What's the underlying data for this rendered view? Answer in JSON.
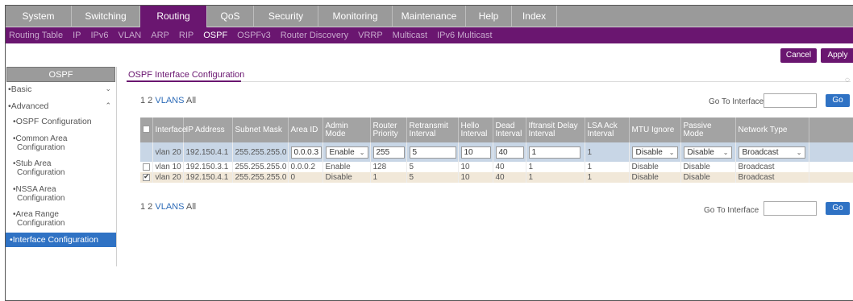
{
  "top_nav": {
    "tabs": [
      {
        "label": "System",
        "width": 82
      },
      {
        "label": "Switching",
        "width": 85
      },
      {
        "label": "Routing",
        "width": 83,
        "active": true
      },
      {
        "label": "QoS",
        "width": 58
      },
      {
        "label": "Security",
        "width": 80
      },
      {
        "label": "Monitoring",
        "width": 92
      },
      {
        "label": "Maintenance",
        "width": 91
      },
      {
        "label": "Help",
        "width": 57
      },
      {
        "label": "Index",
        "width": 56
      }
    ]
  },
  "sub_nav": {
    "items": [
      "Routing Table",
      "IP",
      "IPv6",
      "VLAN",
      "ARP",
      "RIP",
      "OSPF",
      "OSPFv3",
      "Router Discovery",
      "VRRP",
      "Multicast",
      "IPv6 Multicast"
    ],
    "active": "OSPF"
  },
  "buttons": {
    "cancel": "Cancel",
    "apply": "Apply"
  },
  "left_nav": {
    "header": "OSPF",
    "basic": "Basic",
    "advanced": "Advanced",
    "items": {
      "ospf_config": "OSPF Configuration",
      "common_area_1": "Common Area",
      "common_area_2": "Configuration",
      "stub_area_1": "Stub Area",
      "stub_area_2": "Configuration",
      "nssa_area_1": "NSSA Area",
      "nssa_area_2": "Configuration",
      "area_range_1": "Area Range",
      "area_range_2": "Configuration",
      "interface_config": "Interface Configuration"
    }
  },
  "main": {
    "title": "OSPF Interface Configuration",
    "pager_nums": "1 2",
    "pager_vlans": "VLANS",
    "pager_all": "All",
    "goto_label": "Go To Interface",
    "go": "Go"
  },
  "table": {
    "headers": {
      "interface": "Interface",
      "ip": "IP Address",
      "subnet": "Subnet Mask",
      "area": "Area ID",
      "admin": "Admin Mode",
      "priority": "Router Priority",
      "retransmit": "Retransmit Interval",
      "hello": "Hello Interval",
      "dead": "Dead Interval",
      "transit": "Iftransit Delay Interval",
      "lsa": "LSA Ack Interval",
      "mtu": "MTU Ignore",
      "passive": "Passive Mode",
      "network": "Network Type"
    },
    "edit_row": {
      "interface": "vlan 20",
      "ip": "192.150.4.1",
      "subnet": "255.255.255.0",
      "area": "0.0.0.3",
      "admin": "Enable",
      "priority": "255",
      "retransmit": "5",
      "hello": "10",
      "dead": "40",
      "transit": "1",
      "lsa": "1",
      "mtu": "Disable",
      "passive": "Disable",
      "network": "Broadcast"
    },
    "rows": [
      {
        "interface": "vlan 10",
        "ip": "192.150.3.1",
        "subnet": "255.255.255.0",
        "area": "0.0.0.2",
        "admin": "Enable",
        "priority": "128",
        "retransmit": "5",
        "hello": "10",
        "dead": "40",
        "transit": "1",
        "lsa": "1",
        "mtu": "Disable",
        "passive": "Disable",
        "network": "Broadcast",
        "checked": false
      },
      {
        "interface": "vlan 20",
        "ip": "192.150.4.1",
        "subnet": "255.255.255.0",
        "area": "0",
        "admin": "Disable",
        "priority": "1",
        "retransmit": "5",
        "hello": "10",
        "dead": "40",
        "transit": "1",
        "lsa": "1",
        "mtu": "Disable",
        "passive": "Disable",
        "network": "Broadcast",
        "checked": true
      }
    ]
  }
}
